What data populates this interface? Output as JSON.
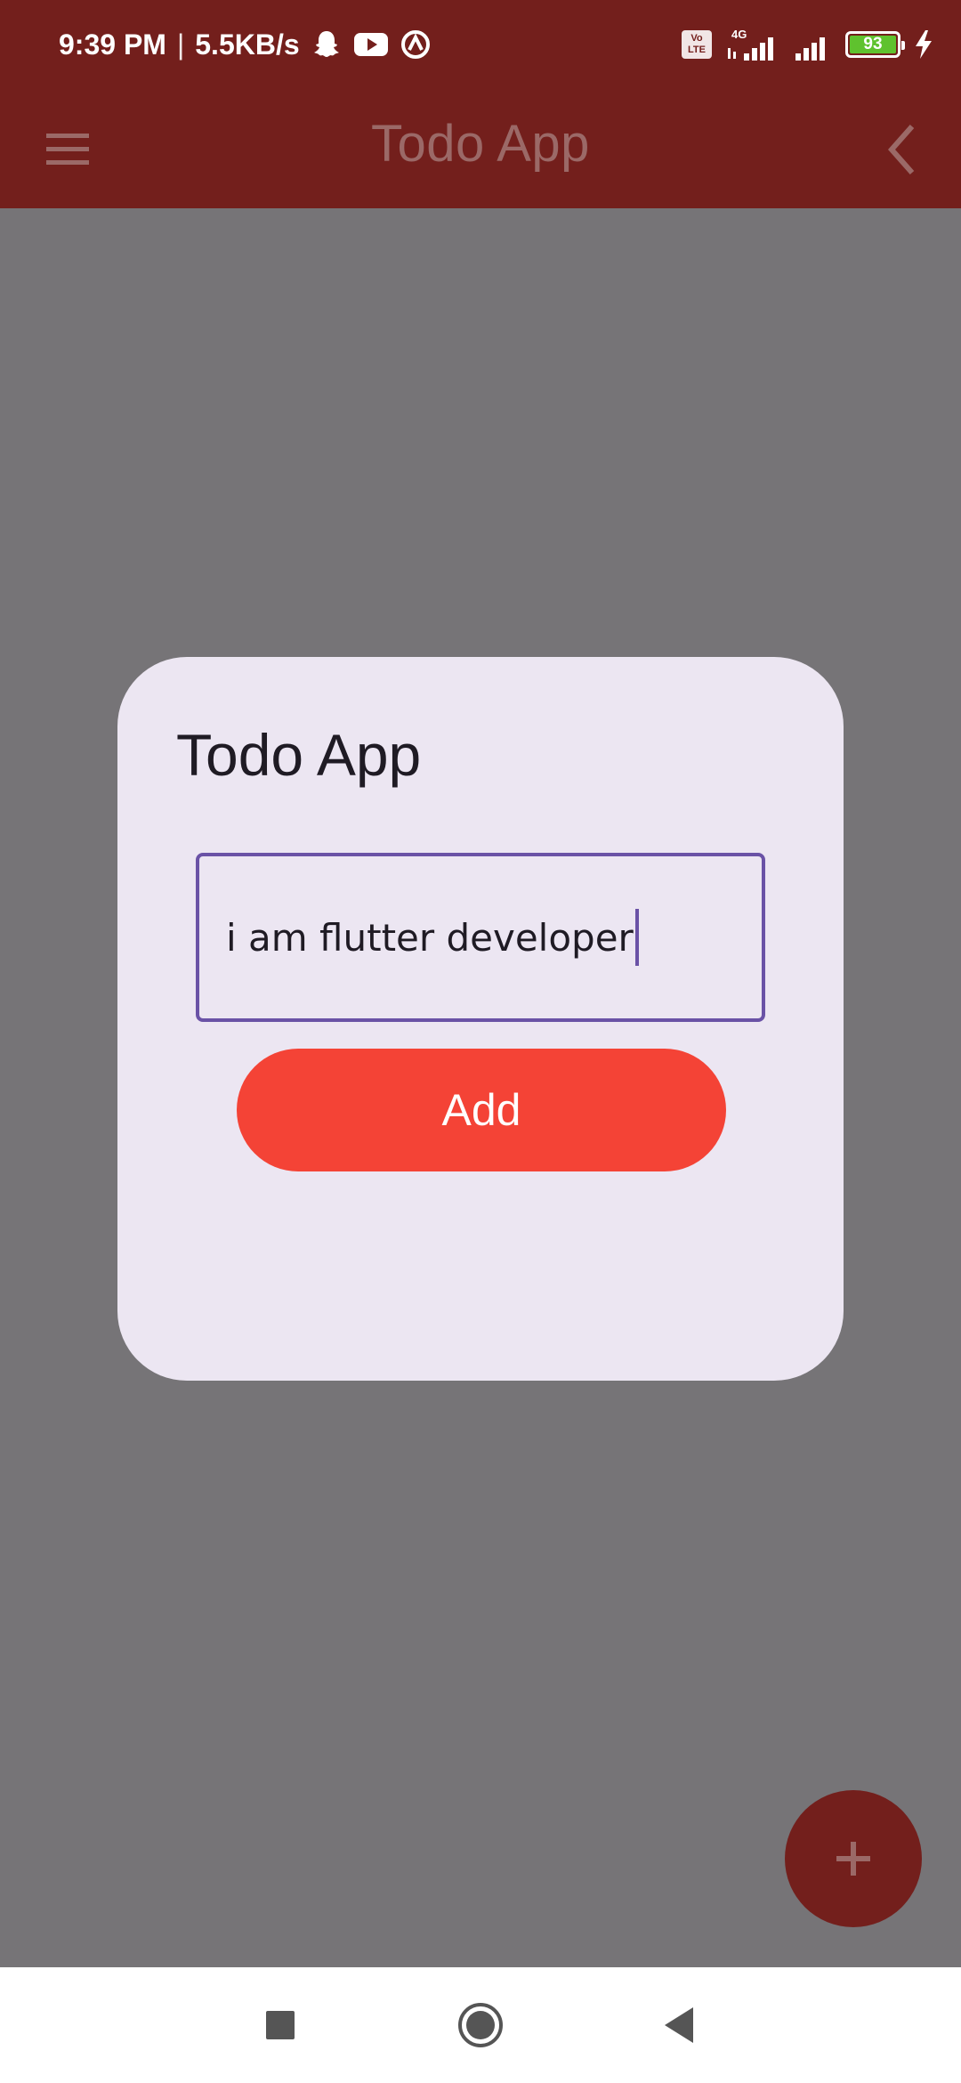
{
  "status_bar": {
    "time": "9:39 PM",
    "separator": "|",
    "net_speed": "5.5KB/s",
    "volte_top": "Vo",
    "volte_bottom": "LTE",
    "network_type": "4G",
    "battery_level": "93",
    "icons": [
      "snapchat-icon",
      "youtube-icon",
      "vpn-icon",
      "volte-icon",
      "signal-icon",
      "battery-icon",
      "charging-icon"
    ]
  },
  "app_bar": {
    "title": "Todo App",
    "menu_icon": "menu-icon",
    "back_icon": "chevron-left-icon"
  },
  "dialog": {
    "title": "Todo App",
    "input_value": "i am flutter developer",
    "add_label": "Add"
  },
  "fab": {
    "icon": "plus-icon"
  },
  "nav_bar": {
    "icons": [
      "recents-icon",
      "home-icon",
      "back-icon"
    ]
  },
  "colors": {
    "primary": "#731f1c",
    "scrim": "#767477",
    "dialog_bg": "#ece6f2",
    "input_border": "#6a52a6",
    "add_button": "#f44336"
  }
}
